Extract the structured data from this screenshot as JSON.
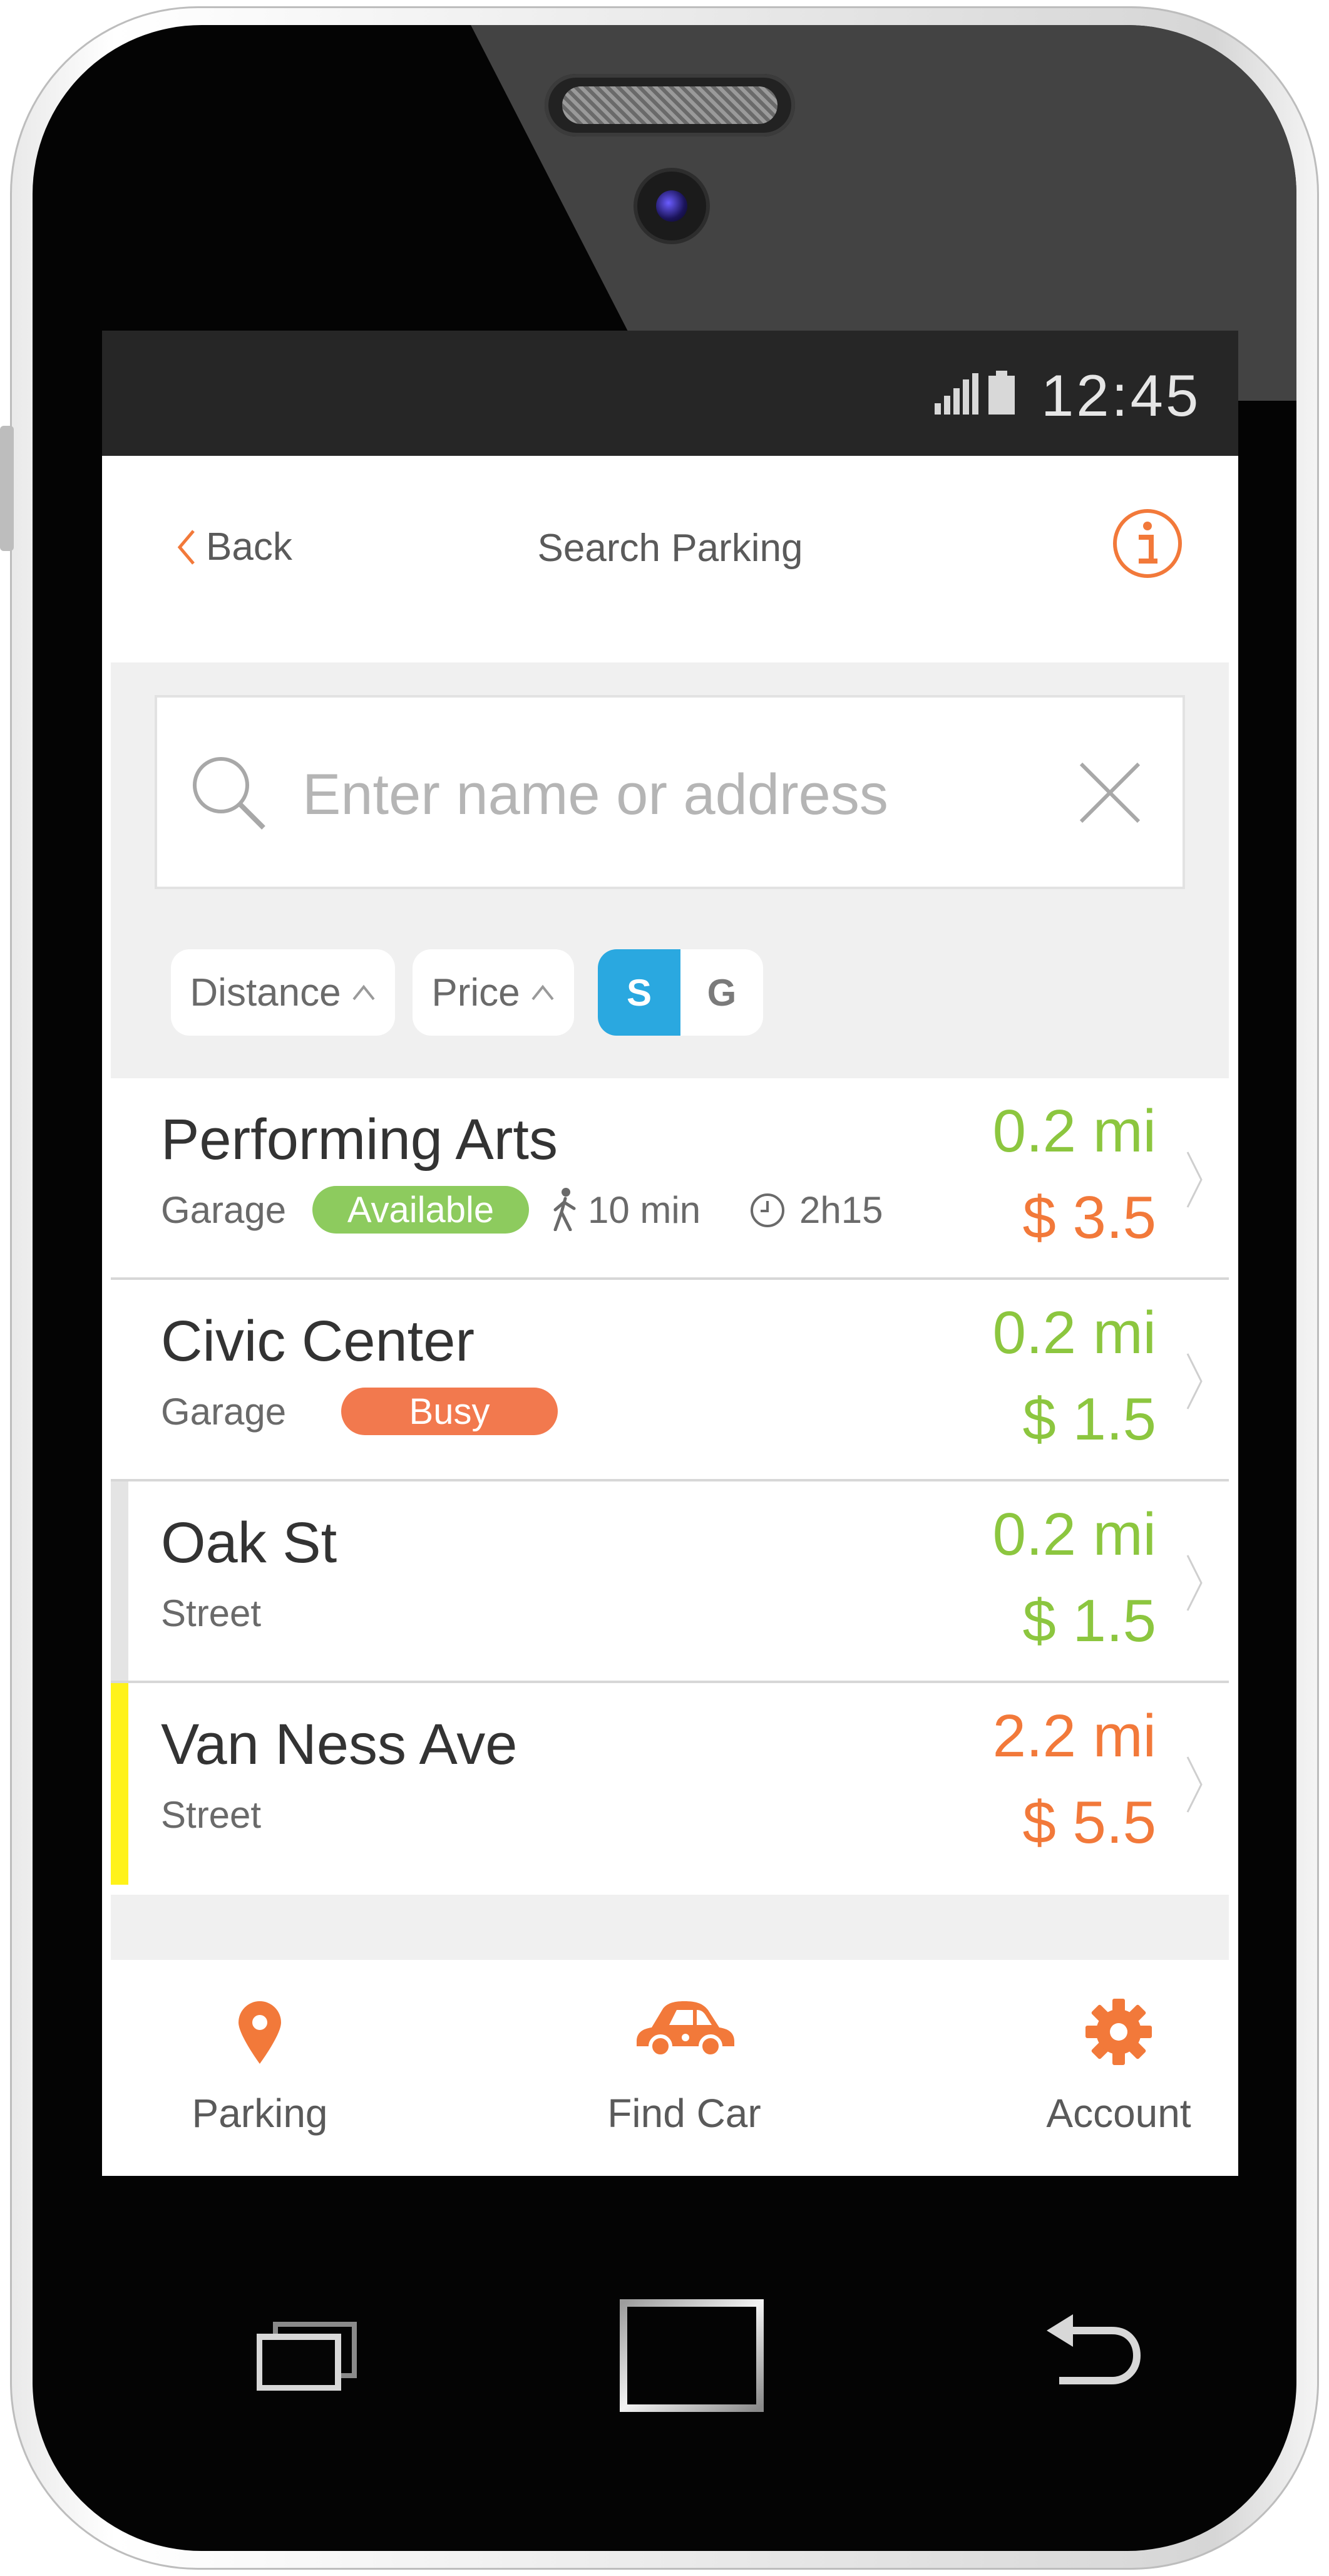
{
  "status_bar": {
    "time": "12:45",
    "signal_icon": "signal-icon",
    "battery_icon": "battery-icon"
  },
  "header": {
    "back_label": "Back",
    "title": "Search Parking",
    "info_icon": "info-icon"
  },
  "search": {
    "placeholder": "Enter name or address",
    "value": ""
  },
  "filters": {
    "distance_label": "Distance",
    "price_label": "Price",
    "toggle": [
      {
        "label": "S",
        "selected": true
      },
      {
        "label": "G",
        "selected": false
      }
    ]
  },
  "results": [
    {
      "name": "Performing Arts",
      "type": "Garage",
      "status": "Available",
      "walk": "10 min",
      "time": "2h15",
      "distance": "0.2 mi",
      "price": "$ 3.5",
      "accent": "#ffffff"
    },
    {
      "name": "Civic Center",
      "type": "Garage",
      "status": "Busy",
      "distance": "0.2 mi",
      "price": "$ 1.5",
      "accent": "#ffffff"
    },
    {
      "name": "Oak St",
      "type": "Street",
      "distance": "0.2 mi",
      "price": "$ 1.5",
      "accent": "#e4e4e4"
    },
    {
      "name": "Van Ness Ave",
      "type": "Street",
      "distance": "2.2 mi",
      "price": "$ 5.5",
      "accent": "#fff21a"
    }
  ],
  "tabs": [
    {
      "label": "Parking",
      "icon": "location-pin-icon"
    },
    {
      "label": "Find Car",
      "icon": "car-icon"
    },
    {
      "label": "Account",
      "icon": "gear-icon"
    }
  ],
  "colors": {
    "accent_orange": "#f2793a",
    "green": "#8cc63f",
    "available_badge": "#8dcb5e",
    "busy_badge": "#f2794e",
    "selected_toggle": "#2aa8e0",
    "warning_yellow": "#fff21a"
  }
}
